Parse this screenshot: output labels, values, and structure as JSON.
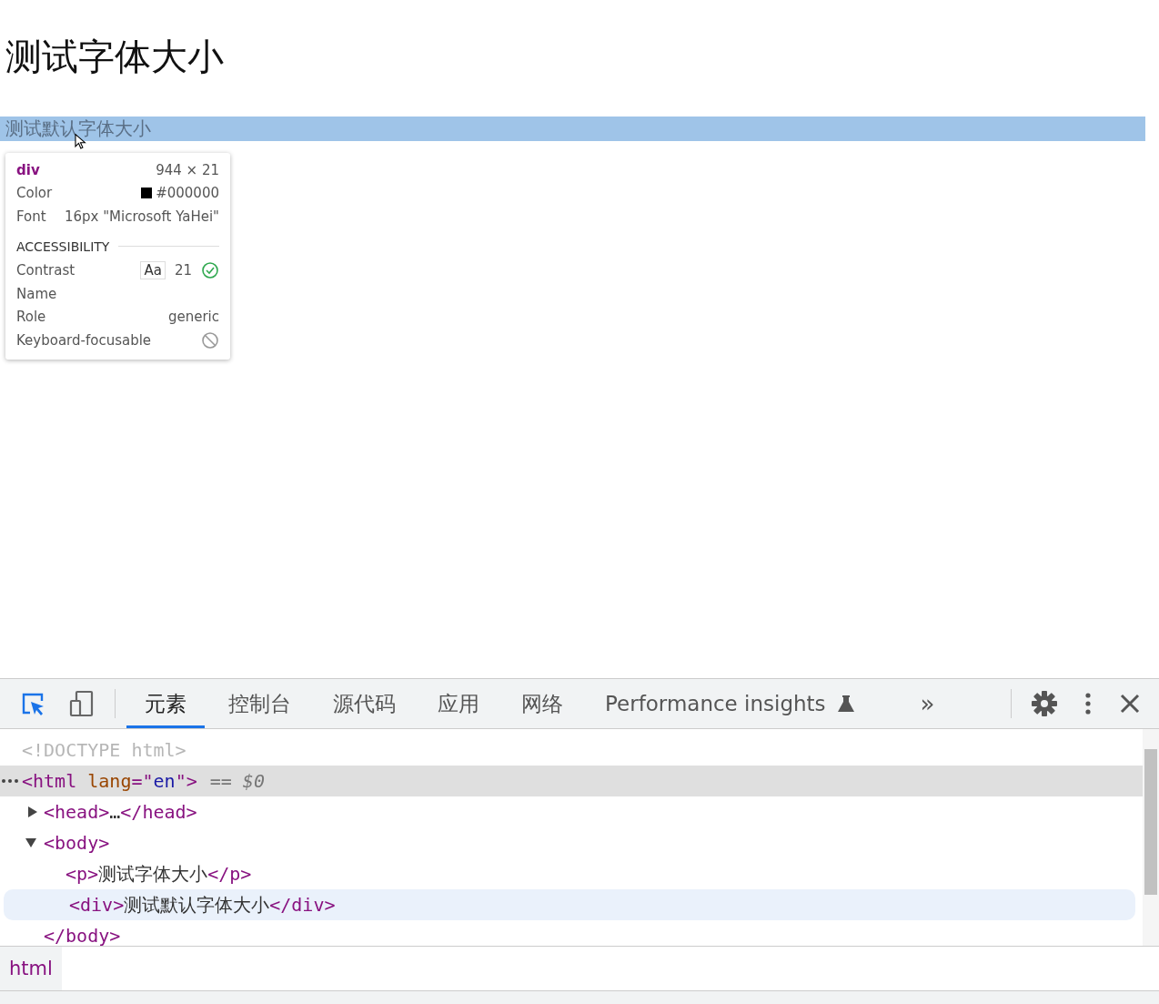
{
  "page": {
    "heading": "测试字体大小",
    "highlighted_text": "测试默认字体大小",
    "highlighted": true
  },
  "tooltip": {
    "tag": "div",
    "size": "944 × 21",
    "section": "ACCESSIBILITY",
    "style_rows": [
      {
        "kind": "color",
        "label": "Color",
        "value": "#000000",
        "color": "#000000"
      },
      {
        "kind": "text",
        "label": "Font",
        "value": "16px \"Microsoft YaHei\""
      }
    ],
    "accessibility_rows": [
      {
        "kind": "contrast",
        "label": "Contrast",
        "sample": "Aa",
        "value": "21",
        "passes": true
      },
      {
        "kind": "text",
        "label": "Name"
      },
      {
        "kind": "text",
        "label": "Role",
        "value": "generic"
      },
      {
        "kind": "focusable",
        "label": "Keyboard-focusable",
        "focusable": false
      }
    ]
  },
  "devtools": {
    "tabs": [
      {
        "label": "元素",
        "selected": true,
        "experimental": false
      },
      {
        "label": "控制台",
        "selected": false,
        "experimental": false
      },
      {
        "label": "源代码",
        "selected": false,
        "experimental": false
      },
      {
        "label": "应用",
        "selected": false,
        "experimental": false
      },
      {
        "label": "网络",
        "selected": false,
        "experimental": false
      },
      {
        "label": "Performance insights",
        "selected": false,
        "experimental": true
      }
    ],
    "more": "»",
    "tree": [
      {
        "kind": "doctype",
        "open": [
          {
            "kind": "doctype",
            "text": "<!DOCTYPE html>"
          }
        ]
      },
      {
        "kind": "element",
        "selected": true,
        "suffix": "== $0",
        "open": [
          {
            "kind": "tag",
            "text": "<html"
          },
          {
            "kind": "attr",
            "text": " lang"
          },
          {
            "kind": "tag",
            "text": "=\""
          },
          {
            "kind": "value",
            "text": "en"
          },
          {
            "kind": "tag",
            "text": "\">"
          }
        ],
        "children": [
          {
            "kind": "element",
            "expanded": false,
            "open": [
              {
                "kind": "tag",
                "text": "<head>"
              },
              {
                "kind": "text",
                "text": "…"
              },
              {
                "kind": "tag",
                "text": "</head>"
              }
            ]
          },
          {
            "kind": "element",
            "expanded": true,
            "open": [
              {
                "kind": "tag",
                "text": "<body>"
              }
            ],
            "close": [
              {
                "kind": "tag",
                "text": "</body>"
              }
            ],
            "children": [
              {
                "kind": "element",
                "open": [
                  {
                    "kind": "tag",
                    "text": "<p>"
                  },
                  {
                    "kind": "text",
                    "text": "测试字体大小"
                  },
                  {
                    "kind": "tag",
                    "text": "</p>"
                  }
                ]
              },
              {
                "kind": "element",
                "hovered": true,
                "open": [
                  {
                    "kind": "tag",
                    "text": "<div>"
                  },
                  {
                    "kind": "text",
                    "text": "测试默认字体大小"
                  },
                  {
                    "kind": "tag",
                    "text": "</div>"
                  }
                ]
              }
            ]
          }
        ]
      }
    ],
    "breadcrumbs": [
      {
        "label": "html",
        "selected": true
      }
    ]
  }
}
